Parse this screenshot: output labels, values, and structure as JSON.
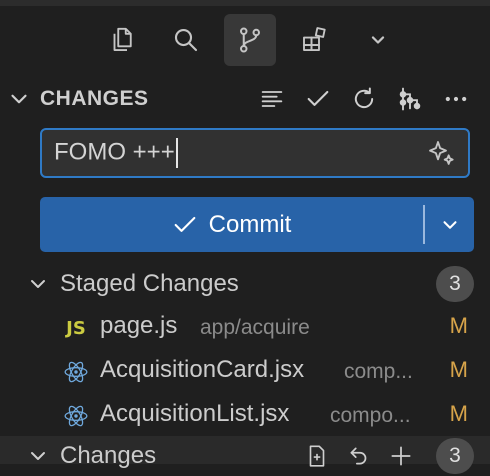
{
  "activity_tabs": [
    {
      "icon": "explorer-icon",
      "active": false
    },
    {
      "icon": "search-icon",
      "active": false
    },
    {
      "icon": "source-control-icon",
      "active": true
    },
    {
      "icon": "extensions-icon",
      "active": false
    },
    {
      "icon": "chevron-down-icon",
      "active": false
    }
  ],
  "section": {
    "title": "CHANGES",
    "actions": [
      "view-as-list-icon",
      "commit-check-icon",
      "refresh-icon",
      "graph-icon",
      "more-icon"
    ]
  },
  "commit_message": {
    "value": "FOMO +++",
    "sparkle_icon": "sparkle-icon"
  },
  "commit_button": {
    "label": "Commit",
    "color": "#2863a8"
  },
  "staged": {
    "label": "Staged Changes",
    "count": "3",
    "files": [
      {
        "icon": "js-icon",
        "icon_text": "JS",
        "name": "page.js",
        "path": "app/acquire",
        "status": "M"
      },
      {
        "icon": "react-icon",
        "name": "AcquisitionCard.jsx",
        "path": "comp...",
        "status": "M"
      },
      {
        "icon": "react-icon",
        "name": "AcquisitionList.jsx",
        "path": "compo...",
        "status": "M"
      }
    ]
  },
  "changes": {
    "label": "Changes",
    "count": "3",
    "actions": [
      "open-file-icon",
      "discard-icon",
      "stage-all-icon"
    ]
  },
  "colors": {
    "accent": "#2f7ac6",
    "modified": "#d7a44a",
    "js": "#cbcb41",
    "react": "#6fa8dc"
  }
}
